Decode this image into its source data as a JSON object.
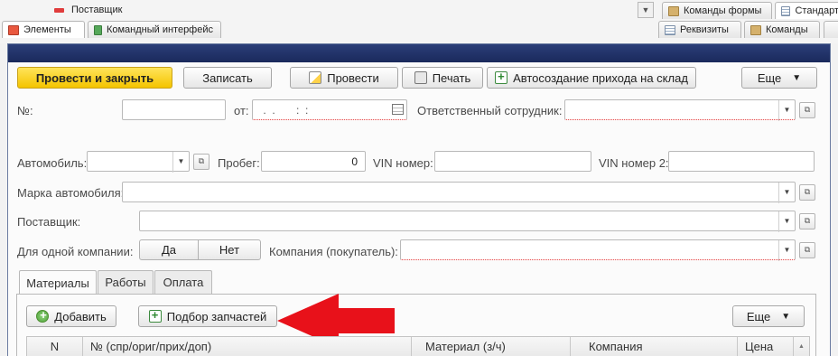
{
  "top": {
    "tree_item": "Поставщик",
    "tabs_left": [
      "Элементы",
      "Командный интерфейс"
    ],
    "tabs_right_top": [
      "Команды формы",
      "Стандарт"
    ],
    "tabs_right_bottom": [
      "Реквизиты",
      "Команды"
    ]
  },
  "toolbar": {
    "post_close": "Провести и закрыть",
    "save": "Записать",
    "post": "Провести",
    "print": "Печать",
    "auto_receipt": "Автосоздание прихода на склад",
    "more": "Еще"
  },
  "fields": {
    "number_label": "№:",
    "number_value": "",
    "date_label": "от:",
    "date_value": " .  .       :  :",
    "employee_label": "Ответственный сотрудник:",
    "car_label": "Автомобиль:",
    "mileage_label": "Пробег:",
    "mileage_value": "0",
    "vin_label": "VIN номер:",
    "vin2_label": "VIN номер 2:",
    "car_brand_label": "Марка автомобиля:",
    "supplier_label": "Поставщик:",
    "one_company_label": "Для одной компании:",
    "yes": "Да",
    "no": "Нет",
    "company_label": "Компания (покупатель):"
  },
  "tabs": [
    "Материалы",
    "Работы",
    "Оплата"
  ],
  "materials": {
    "add": "Добавить",
    "pick_parts": "Подбор запчастей",
    "more": "Еще",
    "columns": [
      "N",
      "№ (спр/ориг/прих/доп)",
      "Материал (з/ч)",
      "Компания",
      "Цена"
    ]
  },
  "colors": {
    "primary_button": "#f4c400",
    "header_bar": "#1f2f66",
    "annotation_arrow": "#e8111a",
    "required_underline": "#e23a3a"
  }
}
